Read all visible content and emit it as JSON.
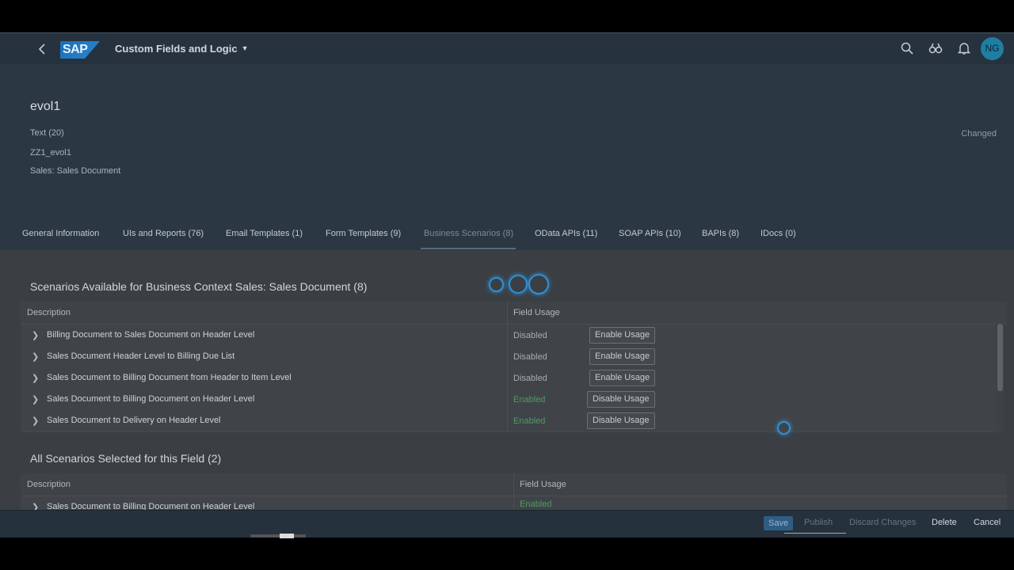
{
  "shell": {
    "title": "Custom Fields and Logic",
    "logo": "SAP",
    "avatar_initials": "NG"
  },
  "object": {
    "title": "evol1",
    "attributes": [
      "Text (20)",
      "ZZ1_evol1",
      "Sales: Sales Document"
    ],
    "status": "Changed"
  },
  "tabs": [
    "General Information",
    "UIs and Reports (76)",
    "Email Templates (1)",
    "Form Templates (9)",
    "Business Scenarios (8)",
    "OData APIs (11)",
    "SOAP APIs (10)",
    "BAPIs (8)",
    "IDocs (0)"
  ],
  "available": {
    "title": "Scenarios Available for Business Context Sales: Sales Document (8)",
    "col_description": "Description",
    "col_usage": "Field Usage",
    "rows": [
      {
        "desc": "Billing Document to Sales Document on Header Level",
        "usage": "Disabled",
        "action": "Enable Usage"
      },
      {
        "desc": "Sales Document Header Level to Billing Due List",
        "usage": "Disabled",
        "action": "Enable Usage"
      },
      {
        "desc": "Sales Document to Billing Document from Header to Item Level",
        "usage": "Disabled",
        "action": "Enable Usage"
      },
      {
        "desc": "Sales Document to Billing Document on Header Level",
        "usage": "Enabled",
        "action": "Disable Usage"
      },
      {
        "desc": "Sales Document to Delivery on Header Level",
        "usage": "Enabled",
        "action": "Disable Usage"
      }
    ]
  },
  "selected": {
    "title": "All Scenarios Selected for this Field (2)",
    "col_description": "Description",
    "col_usage": "Field Usage",
    "rows": [
      {
        "desc": "Sales Document to Billing Document on Header Level",
        "usage": "Enabled"
      }
    ]
  },
  "footer": {
    "save": "Save",
    "publish": "Publish",
    "discard": "Discard Changes",
    "delete": "Delete",
    "cancel": "Cancel"
  }
}
